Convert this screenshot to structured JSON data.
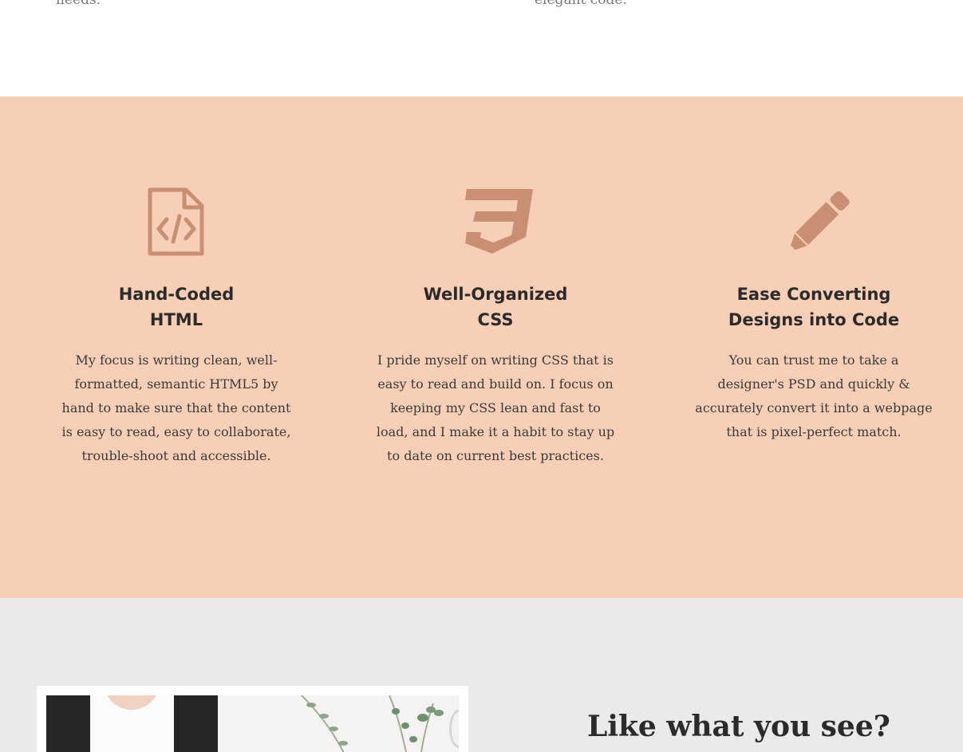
{
  "top": {
    "left_tail": "needs.",
    "right_tail": "elegant code."
  },
  "features": {
    "items": [
      {
        "icon": "file-code-icon",
        "title": "Hand-Coded\nHTML",
        "text": "My focus is writing clean, well-formatted, semantic HTML5 by hand to make sure that the content is easy to read, easy to collaborate, trouble-shoot and accessible."
      },
      {
        "icon": "css3-icon",
        "title": "Well-Organized\nCSS",
        "text": "I pride myself on writing CSS that is easy to read and build on. I focus on keeping my CSS lean and fast to load, and I make it a habit to stay up to date on current best practices."
      },
      {
        "icon": "pencil-icon",
        "title": "Ease Converting\nDesigns into Code",
        "text": "You can trust me to take a designer's PSD and quickly & accurately convert it into a webpage that is pixel-perfect match."
      }
    ]
  },
  "about": {
    "heading": "Like what you see?"
  },
  "colors": {
    "features_bg": "#f7ceb6",
    "icon": "#c98f73",
    "about_bg": "#eaeaea",
    "text": "#2b2b2b"
  }
}
